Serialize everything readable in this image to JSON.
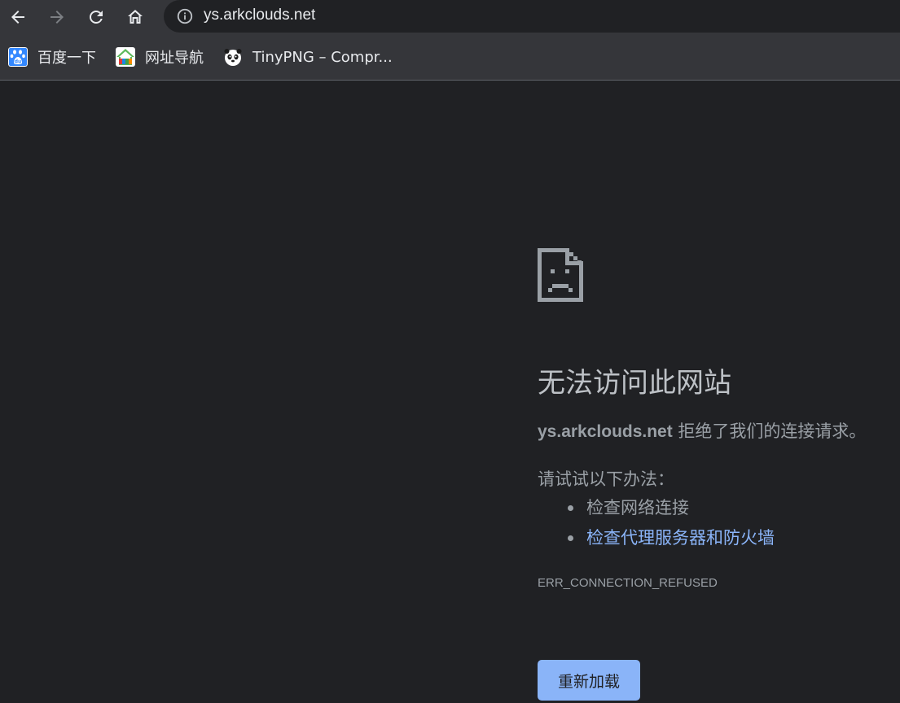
{
  "toolbar": {
    "back_icon": "arrow-left-icon",
    "forward_icon": "arrow-right-icon",
    "reload_icon": "reload-icon",
    "home_icon": "home-icon",
    "info_icon": "info-icon",
    "url": "ys.arkclouds.net"
  },
  "bookmarks": [
    {
      "label": "百度一下",
      "icon": "baidu-paw-icon"
    },
    {
      "label": "网址导航",
      "icon": "2345-house-icon"
    },
    {
      "label": "TinyPNG – Compr...",
      "icon": "tinypng-panda-icon"
    }
  ],
  "error": {
    "icon": "sad-page-icon",
    "title": "无法访问此网站",
    "host": "ys.arkclouds.net",
    "message": " 拒绝了我们的连接请求。",
    "try_label": "请试试以下办法：",
    "suggestions": [
      {
        "label": "检查网络连接"
      },
      {
        "label": "检查代理服务器和防火墙"
      }
    ],
    "code": "ERR_CONNECTION_REFUSED",
    "reload_label": "重新加载"
  },
  "colors": {
    "background": "#202124",
    "toolbar": "#35363a",
    "text": "#9aa0a6",
    "title": "#bdc1c6",
    "link": "#8ab4f8",
    "button": "#8ab4f8"
  }
}
